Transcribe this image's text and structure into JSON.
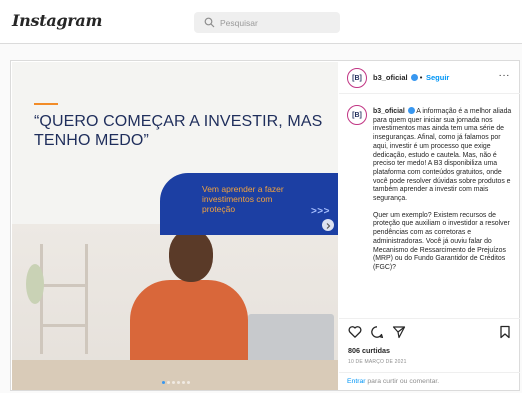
{
  "app": {
    "logo": "Instagram"
  },
  "search": {
    "placeholder": "Pesquisar"
  },
  "media": {
    "quote": "“QUERO COMEÇAR A INVESTIR, MAS TENHO MEDO”",
    "panel_text": "Vem aprender a fazer investimentos com proteção",
    "panel_arrows": ">>>",
    "carousel": {
      "count": 6,
      "active_index": 0
    }
  },
  "post_header": {
    "avatar_text": "[B]",
    "username": "b3_oficial",
    "separator": "•",
    "follow_label": "Seguir",
    "more_label": "···"
  },
  "caption": {
    "username": "b3_oficial",
    "paragraph_1": "A informação é a melhor aliada para quem quer iniciar sua jornada nos investimentos mas ainda tem uma série de inseguranças. Afinal, como já falamos por aqui, investir é um processo que exige dedicação, estudo e cautela. Mas, não é preciso ter medo! A B3 disponibiliza uma plataforma com conteúdos gratuitos, onde você pode resolver dúvidas sobre produtos e também aprender a investir com mais segurança.",
    "paragraph_2": "Quer um exemplo? Existem recursos de proteção que auxiliam o investidor a resolver pendências com as corretoras e administradoras. Você já ouviu falar do Mecanismo de Ressarcimento de Prejuízos (MRP) ou do Fundo Garantidor de Créditos (FGC)?"
  },
  "actions": {
    "likes": "806 curtidas",
    "date": "10 DE MARÇO DE 2021",
    "add_comment_link": "Entrar",
    "add_comment_rest": " para curtir ou comentar."
  },
  "colors": {
    "brand_blue": "#1c3fa3",
    "accent_orange": "#f28c28",
    "link_blue": "#0095f6"
  }
}
